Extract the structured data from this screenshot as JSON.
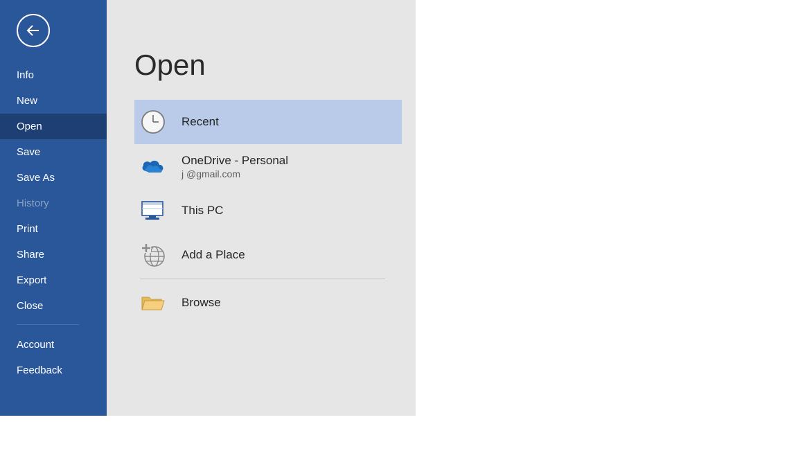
{
  "sidebar": {
    "items": [
      {
        "label": "Info"
      },
      {
        "label": "New"
      },
      {
        "label": "Open"
      },
      {
        "label": "Save"
      },
      {
        "label": "Save As"
      },
      {
        "label": "History"
      },
      {
        "label": "Print"
      },
      {
        "label": "Share"
      },
      {
        "label": "Export"
      },
      {
        "label": "Close"
      },
      {
        "label": "Account"
      },
      {
        "label": "Feedback"
      }
    ]
  },
  "panel": {
    "heading": "Open",
    "locations": {
      "recent": {
        "label": "Recent"
      },
      "onedrive": {
        "label": "OneDrive - Personal",
        "sub": "j                       @gmail.com"
      },
      "thispc": {
        "label": "This PC"
      },
      "addplace": {
        "label": "Add a Place"
      },
      "browse": {
        "label": "Browse"
      }
    }
  }
}
